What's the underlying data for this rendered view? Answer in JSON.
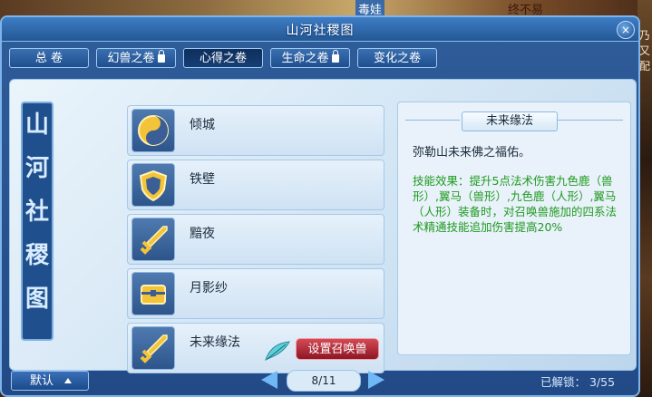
{
  "background": {
    "top_texts": [
      "",
      "",
      "",
      "毒娃",
      "终不易"
    ],
    "right_text": "乃又配"
  },
  "window": {
    "title": "山河社稷图",
    "close_label": "×"
  },
  "tabs": [
    {
      "label": "总 卷",
      "locked": false,
      "active": false
    },
    {
      "label": "幻兽之卷",
      "locked": true,
      "active": false
    },
    {
      "label": "心得之卷",
      "locked": false,
      "active": true
    },
    {
      "label": "生命之卷",
      "locked": true,
      "active": false
    },
    {
      "label": "变化之卷",
      "locked": false,
      "active": false
    }
  ],
  "seal": [
    "山",
    "河",
    "社",
    "稷",
    "图"
  ],
  "items": [
    {
      "label": "倾城",
      "icon": "yin-yang-icon"
    },
    {
      "label": "铁壁",
      "icon": "shield-icon"
    },
    {
      "label": "黯夜",
      "icon": "sword-icon"
    },
    {
      "label": "月影纱",
      "icon": "chest-icon"
    },
    {
      "label": "未来缘法",
      "icon": "sword-icon",
      "action_label": "设置召唤兽"
    }
  ],
  "detail": {
    "title": "未来缘法",
    "description": "弥勒山未来佛之福佑。",
    "effect": "技能效果：提升5点法术伤害九色鹿（兽形）,翼马（兽形）,九色鹿（人形）,翼马（人形）装备时，对召唤兽施加的四系法术精通技能追加伤害提高20%"
  },
  "bottom": {
    "default_label": "默认",
    "page": "8/11",
    "unlocked": "已解锁：  3/55"
  },
  "colors": {
    "window_blue": "#224a86",
    "effect_green": "#1f9a1f",
    "action_red": "#c23342"
  }
}
